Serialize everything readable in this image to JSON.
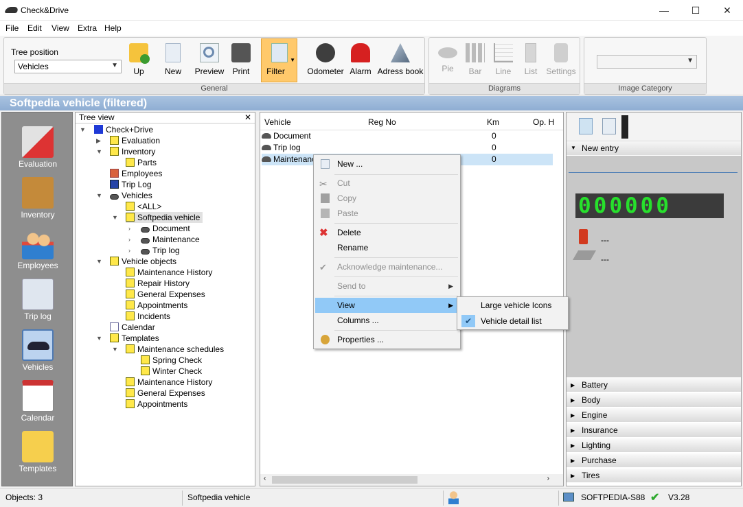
{
  "window": {
    "title": "Check&Drive",
    "minimize": "—",
    "maximize": "☐",
    "close": "✕"
  },
  "menu": [
    "File",
    "Edit",
    "View",
    "Extra",
    "Help"
  ],
  "ribbon": {
    "tree_position_label": "Tree position",
    "tree_position_value": "Vehicles",
    "buttons": [
      "Up",
      "New",
      "Preview",
      "Print",
      "Filter",
      "Odometer",
      "Alarm",
      "Adress book"
    ],
    "general_label": "General",
    "diagram_buttons": [
      "Pie",
      "Bar",
      "Line",
      "List",
      "Settings"
    ],
    "diagrams_label": "Diagrams",
    "image_category_label": "Image Category",
    "image_category_value": ""
  },
  "view_title": "Softpedia vehicle (filtered)",
  "nav": [
    "Evaluation",
    "Inventory",
    "Employees",
    "Trip log",
    "Vehicles",
    "Calendar",
    "Templates"
  ],
  "tree": {
    "header": "Tree view",
    "close": "✕",
    "nodes": [
      "Check+Drive",
      "Evaluation",
      "Inventory",
      "Parts",
      "Employees",
      "Trip Log",
      "Vehicles",
      "<ALL>",
      "Softpedia vehicle",
      "Document",
      "Maintenance",
      "Trip log",
      "Vehicle objects",
      "Maintenance History",
      "Repair History",
      "General Expenses",
      "Appointments",
      "Incidents",
      "Calendar",
      "Templates",
      "Maintenance schedules",
      "Spring Check",
      "Winter Check",
      "Maintenance History",
      "General Expenses",
      "Appointments"
    ]
  },
  "list": {
    "columns": [
      "Vehicle",
      "Reg No",
      "Km",
      "Op. H"
    ],
    "rows": [
      {
        "vehicle": "Document",
        "km": "0"
      },
      {
        "vehicle": "Trip log",
        "km": "0"
      },
      {
        "vehicle": "Maintenance",
        "km": "0"
      }
    ]
  },
  "context_menu": {
    "items": [
      "New ...",
      "Cut",
      "Copy",
      "Paste",
      "Delete",
      "Rename",
      "Acknowledge maintenance...",
      "Send to",
      "View",
      "Columns ...",
      "Properties ..."
    ],
    "submenu": [
      "Large vehicle Icons",
      "Vehicle detail list"
    ]
  },
  "right_panel": {
    "new_entry": "New entry",
    "odometer": "000000",
    "fuel_value": "---",
    "misc_value": "---",
    "categories": [
      "Battery",
      "Body",
      "Engine",
      "Insurance",
      "Lighting",
      "Purchase",
      "Tires"
    ]
  },
  "status": {
    "objects": "Objects: 3",
    "vehicle": "Softpedia vehicle",
    "computer": "SOFTPEDIA-S88",
    "version": "V3.28"
  }
}
